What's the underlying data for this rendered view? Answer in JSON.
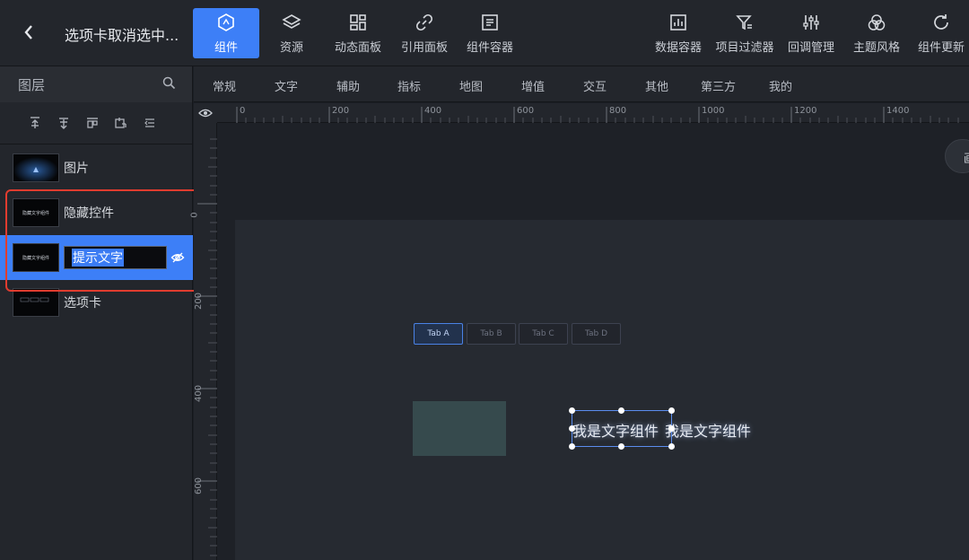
{
  "header": {
    "title": "选项卡取消选中...",
    "tools_left": [
      {
        "label": "组件",
        "icon": "component-icon",
        "active": true
      },
      {
        "label": "资源",
        "icon": "layers-icon",
        "active": false
      },
      {
        "label": "动态面板",
        "icon": "panel-icon",
        "active": false
      },
      {
        "label": "引用面板",
        "icon": "link-icon",
        "active": false
      },
      {
        "label": "组件容器",
        "icon": "container-icon",
        "active": false
      }
    ],
    "tools_right": [
      {
        "label": "数据容器",
        "icon": "chart-icon"
      },
      {
        "label": "项目过滤器",
        "icon": "filter-icon"
      },
      {
        "label": "回调管理",
        "icon": "sliders-icon"
      },
      {
        "label": "主题风格",
        "icon": "theme-icon"
      },
      {
        "label": "组件更新",
        "icon": "refresh-icon"
      }
    ]
  },
  "layers_panel": {
    "title": "图层",
    "items": [
      {
        "name": "图片"
      },
      {
        "name": "隐藏控件"
      },
      {
        "name": "提示文字",
        "editing": true
      },
      {
        "name": "选项卡"
      }
    ],
    "thumb_text": "隐藏文字组件"
  },
  "categories": [
    "常规",
    "文字",
    "辅助",
    "指标",
    "地图",
    "增值",
    "交互",
    "其他",
    "第三方",
    "我的"
  ],
  "rulers": {
    "horizontal": [
      "0",
      "200",
      "400",
      "600",
      "800",
      "1000",
      "1200",
      "1400"
    ],
    "vertical": [
      "0",
      "200",
      "400",
      "600"
    ]
  },
  "canvas": {
    "tabs": [
      {
        "label": "Tab A",
        "active": true
      },
      {
        "label": "Tab B",
        "active": false
      },
      {
        "label": "Tab C",
        "active": false
      },
      {
        "label": "Tab D",
        "active": false
      }
    ],
    "text_component_1": "我是文字组件",
    "text_component_2": "我是文字组件",
    "float_button_text": "画"
  },
  "colors": {
    "accent": "#3d7ff7",
    "highlight_border": "#e03c2f"
  }
}
